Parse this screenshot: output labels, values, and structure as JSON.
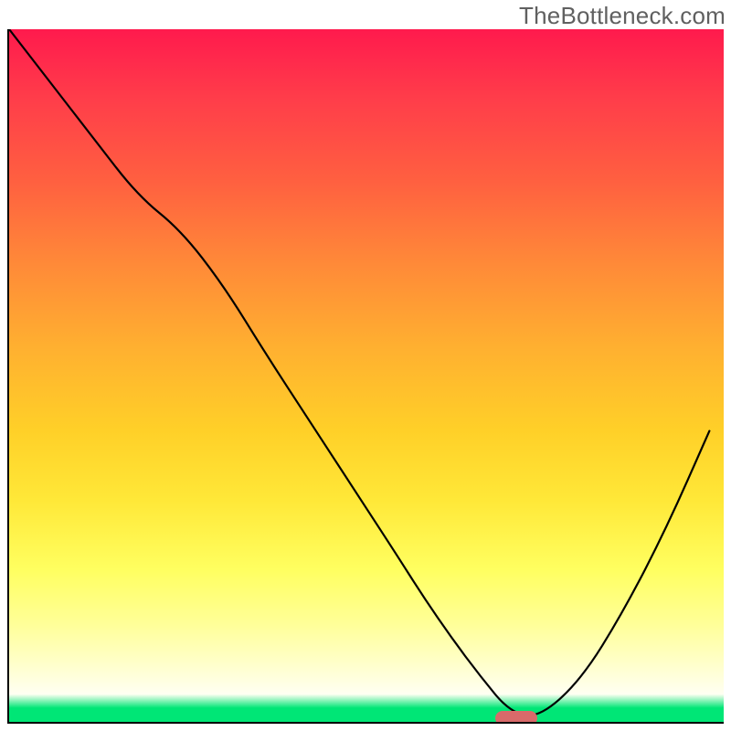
{
  "watermark": {
    "text": "TheBottleneck.com"
  },
  "chart_data": {
    "type": "line",
    "title": "",
    "xlabel": "",
    "ylabel": "",
    "x_range": [
      0,
      100
    ],
    "y_range": [
      0,
      100
    ],
    "legend": false,
    "grid": false,
    "notes": "No axes tick labels or units are rendered in the image; x/y values below are normalized 0–100 where 100 = top/right of plot frame. Gradient background transitions red→yellow→green top to bottom. A single pink rounded marker sits at the curve minimum on the x-axis.",
    "series": [
      {
        "name": "bottleneck-curve",
        "x": [
          0,
          6,
          12,
          18,
          24,
          30,
          36,
          42,
          48,
          54,
          58,
          62,
          66,
          70,
          74,
          80,
          86,
          92,
          98
        ],
        "y": [
          100,
          92,
          84,
          76,
          71,
          63,
          53,
          43.5,
          34,
          24.5,
          18,
          12,
          6.5,
          1.5,
          0.5,
          6,
          16,
          28,
          42
        ]
      }
    ],
    "marker": {
      "name": "optimal-point",
      "x": 71,
      "y": 0.5,
      "shape": "rounded-rect",
      "color": "#d86a6a"
    },
    "background": {
      "type": "vertical-gradient",
      "stops": [
        {
          "pos": 0.0,
          "color": "#ff1a4d"
        },
        {
          "pos": 0.46,
          "color": "#ffb030"
        },
        {
          "pos": 0.78,
          "color": "#ffff60"
        },
        {
          "pos": 0.96,
          "color": "#fffff2"
        },
        {
          "pos": 1.0,
          "color": "#00e676"
        }
      ]
    }
  }
}
